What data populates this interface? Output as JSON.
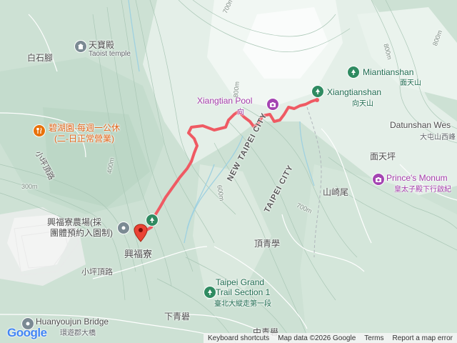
{
  "places": {
    "baishijiao": "白石腳",
    "tianbao_zh": "天寶殿",
    "tianbao_en": "Taoist temple",
    "bihu_line1": "碧湖園-每週一公休",
    "bihu_line2": "(二-日正常營業)",
    "xiangtian_pool_en": "Xiangtian Pool",
    "xiangtian_pool_zh": "向",
    "xiangtianshan_en": "Xiangtianshan",
    "xiangtianshan_zh": "向天山",
    "miantianshan_en": "Miantianshan",
    "miantianshan_zh": "面天山",
    "datunshan_en": "Datunshan Wes",
    "datunshan_zh": "大屯山西峰",
    "miantianping": "面天坪",
    "princes_en": "Prince's Monum",
    "princes_zh": "皇太子殿下行啟紀",
    "shanqiwei": "山崎尾",
    "new_taipei": "NEW TAIPEI CITY",
    "taipei": "TAIPEI CITY",
    "dingqingxue": "頂青學",
    "farm_line1": "興福寮農場(採",
    "farm_line2": "團體預約入園制)",
    "xingfuliao": "興福寮",
    "xiaopingding_road1": "小坪頂路",
    "xiaopingding_road2": "小坪頂路",
    "grand_trail_line1": "Taipei Grand",
    "grand_trail_line2": "Trail Section 1",
    "grand_trail_zh": "臺北大縱走第一段",
    "xiaqingxue": "下青礐",
    "zhongqingxue": "中青礐",
    "huanyoujun_en": "Huanyoujun Bridge",
    "huanyoujun_zh": "環遊郡大橋"
  },
  "contours": {
    "c700a": "700m",
    "c700b": "700m",
    "c800a": "800m",
    "c800b": "800m",
    "c600": "600m",
    "c400": "400m",
    "c300": "300m",
    "c800c": "800m"
  },
  "icons": {
    "park": "tree-icon",
    "camera": "camera-icon",
    "food": "fork-knife-icon",
    "temple": "temple-icon",
    "pin": "location-pin-icon"
  },
  "colors": {
    "route": "#ef5a63",
    "park_pin": "#2f8b61",
    "camera_pin": "#a445b2",
    "food_pin": "#e8710a"
  },
  "footer": {
    "logo": "Google",
    "keyboard": "Keyboard shortcuts",
    "mapdata": "Map data ©2026 Google",
    "terms": "Terms",
    "report": "Report a map error"
  }
}
